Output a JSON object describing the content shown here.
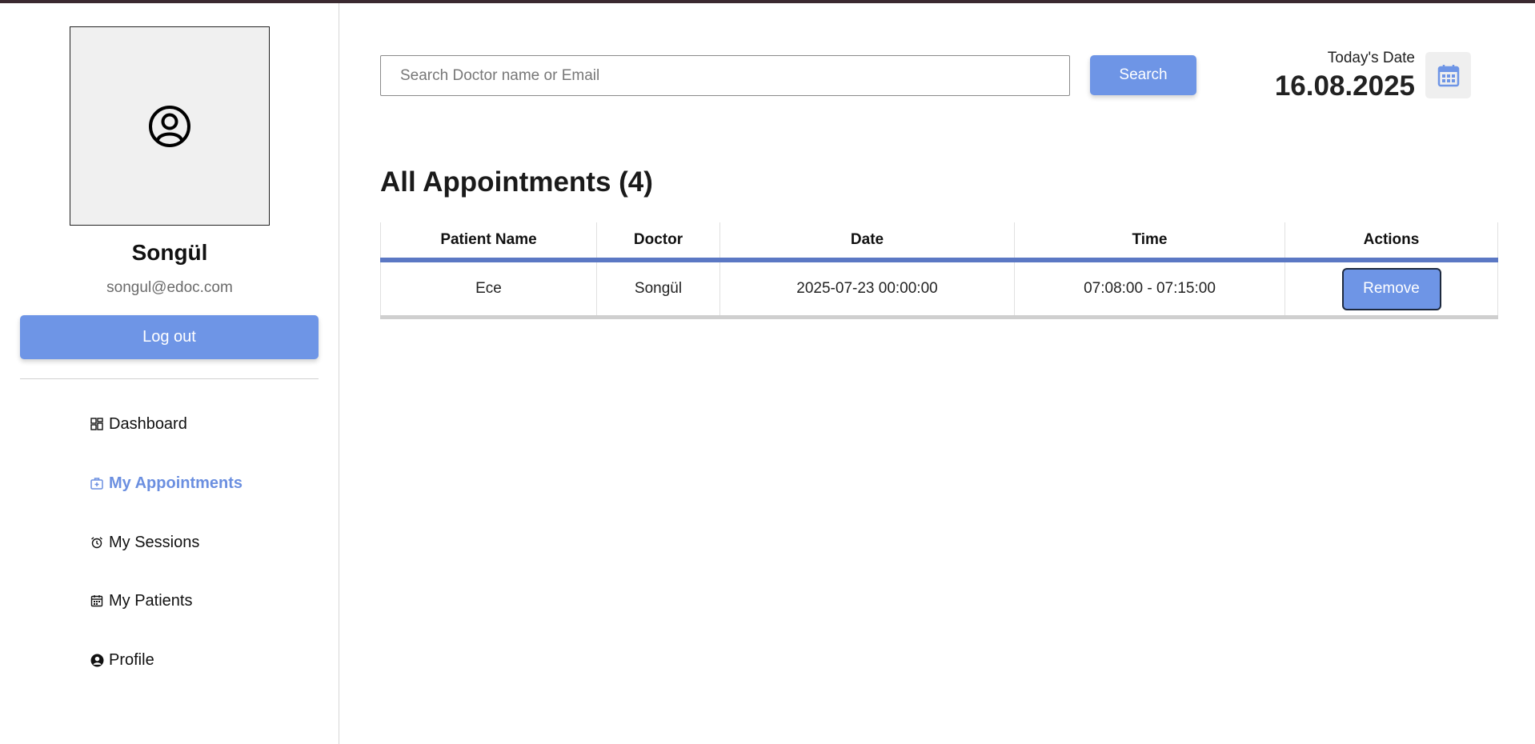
{
  "profile": {
    "name": "Songül",
    "email": "songul@edoc.com",
    "logout_label": "Log out"
  },
  "menu": [
    {
      "label": "Dashboard",
      "icon": "dashboard-icon",
      "active": false
    },
    {
      "label": "My Appointments",
      "icon": "medical-bag-icon",
      "active": true
    },
    {
      "label": "My Sessions",
      "icon": "alarm-clock-icon",
      "active": false
    },
    {
      "label": "My Patients",
      "icon": "calendar-icon",
      "active": false
    },
    {
      "label": "Profile",
      "icon": "user-circle-icon",
      "active": false
    }
  ],
  "search": {
    "placeholder": "Search Doctor name or Email",
    "value": "",
    "button_label": "Search"
  },
  "date": {
    "label": "Today's Date",
    "value": "16.08.2025"
  },
  "appointments": {
    "title": "All Appointments (4)",
    "columns": [
      "Patient Name",
      "Doctor",
      "Date",
      "Time",
      "Actions"
    ],
    "rows": [
      {
        "patient": "Ece",
        "doctor": "Songül",
        "date": "2025-07-23 00:00:00",
        "time": "07:08:00 - 07:15:00",
        "action_label": "Remove"
      }
    ]
  },
  "colors": {
    "accent": "#6e95e6",
    "active_menu": "#6b8fe0",
    "table_header_border": "#5b78c4",
    "top_bar": "#3b2a30"
  }
}
